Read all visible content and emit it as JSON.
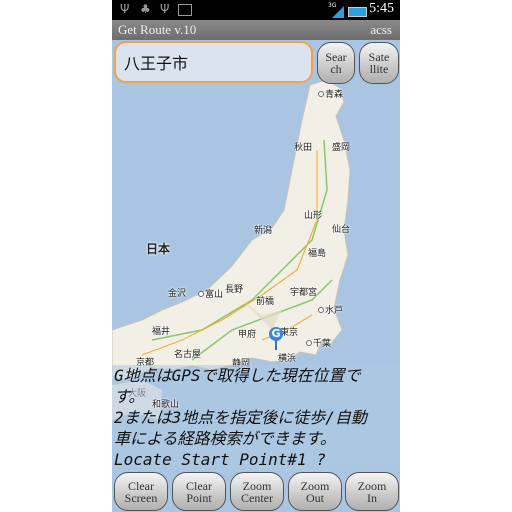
{
  "status_bar": {
    "time": "5:45",
    "network": "3G",
    "icons": [
      "usb-icon",
      "android-icon",
      "usb-icon",
      "image-icon",
      "signal-icon",
      "battery-icon"
    ]
  },
  "titlebar": {
    "title": "Get Route v.10",
    "right_text": "acss"
  },
  "search": {
    "value": "八王子市"
  },
  "buttons": {
    "search": [
      "Sear",
      "ch"
    ],
    "satellite": [
      "Sate",
      "llite"
    ]
  },
  "map": {
    "labels": [
      "青森",
      "秋田",
      "盛岡",
      "山形",
      "仙台",
      "新潟",
      "日本",
      "福島",
      "金沢",
      "富山",
      "長野",
      "前橋",
      "宇都宮",
      "水戸",
      "福井",
      "甲府",
      "東京",
      "千葉",
      "京都",
      "名古屋",
      "静岡",
      "横浜",
      "大阪",
      "和歌山"
    ],
    "marker": "G"
  },
  "message": {
    "lines": [
      "G地点はGPSで取得した現在位置で",
      "す。",
      "2または3地点を指定後に徒歩/自動",
      "車による経路検索ができます。",
      "Locate Start Point#1 ?"
    ]
  },
  "bottom_buttons": [
    {
      "l1": "Clear",
      "l2": "Screen"
    },
    {
      "l1": "Clear",
      "l2": "Point"
    },
    {
      "l1": "Zoom",
      "l2": "Center"
    },
    {
      "l1": "Zoom",
      "l2": "Out"
    },
    {
      "l1": "Zoom",
      "l2": "In"
    }
  ],
  "colors": {
    "sea": "#a9c5e2",
    "land": "#f2efe6",
    "search_border": "#f5a04a",
    "marker": "#3a86d8"
  }
}
